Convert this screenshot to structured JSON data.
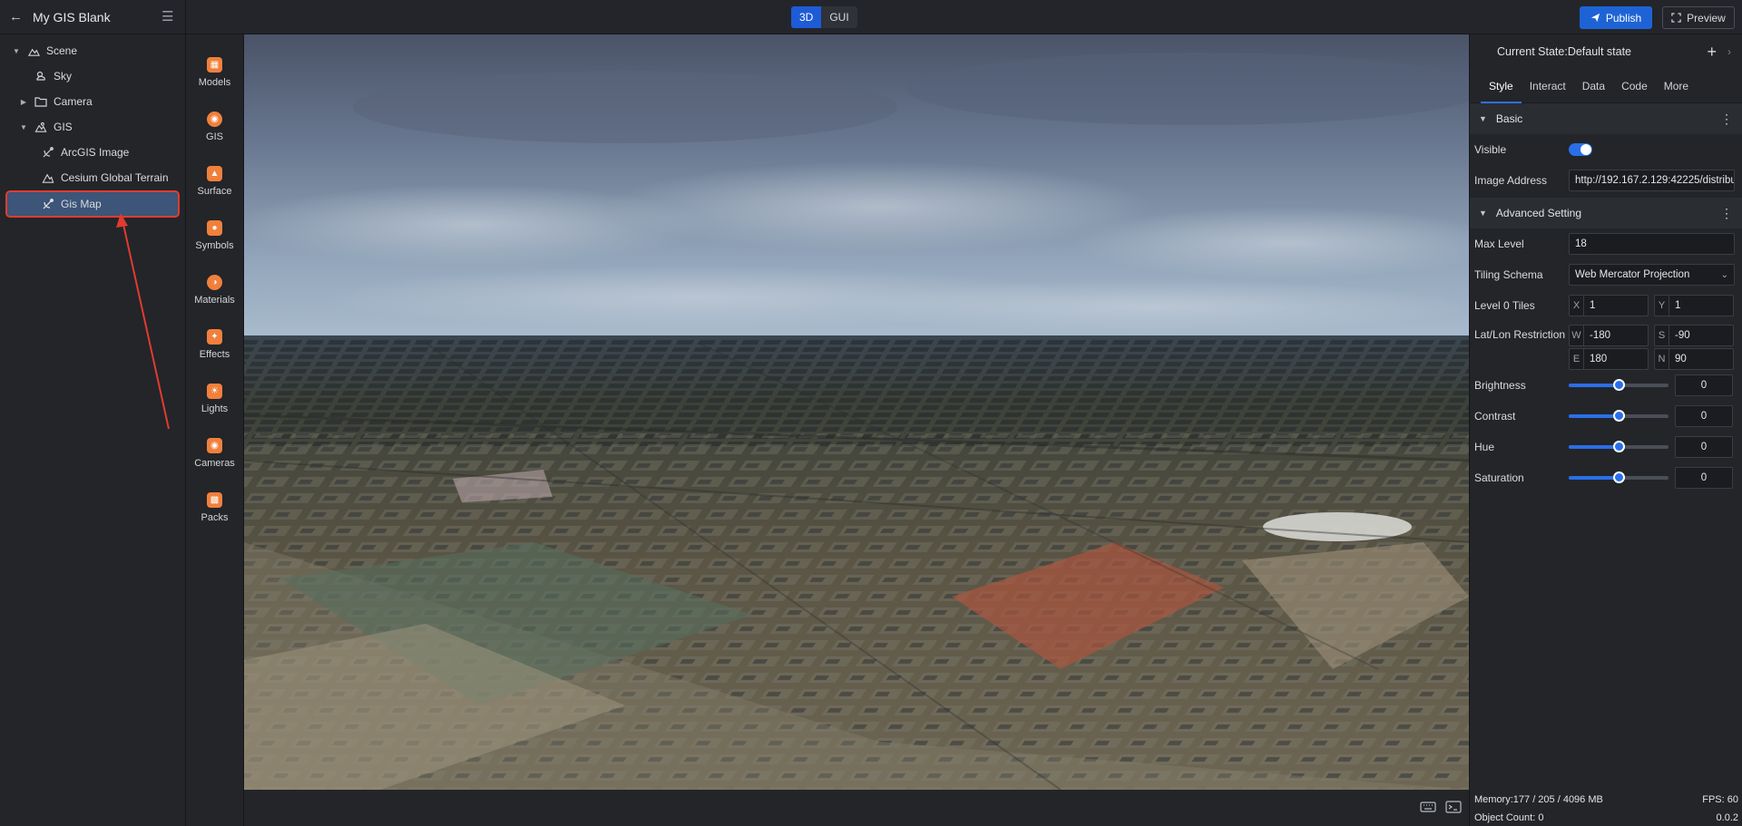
{
  "header": {
    "title": "My GIS Blank",
    "modes": [
      "3D",
      "GUI"
    ],
    "publish_label": "Publish",
    "preview_label": "Preview"
  },
  "tree": [
    {
      "label": "Scene",
      "icon": "scene-icon",
      "expanded": true
    },
    {
      "label": "Sky",
      "icon": "sky-icon"
    },
    {
      "label": "Camera",
      "icon": "folder-icon",
      "expanded": false
    },
    {
      "label": "GIS",
      "icon": "gis-icon",
      "expanded": true
    },
    {
      "label": "ArcGIS Image",
      "icon": "satellite-icon"
    },
    {
      "label": "Cesium Global Terrain",
      "icon": "terrain-icon"
    },
    {
      "label": "Gis Map",
      "icon": "satellite-icon",
      "selected": true
    }
  ],
  "tools": [
    "Models",
    "GIS",
    "Surface",
    "Symbols",
    "Materials",
    "Effects",
    "Lights",
    "Cameras",
    "Packs"
  ],
  "panel": {
    "state_label": "Current State:Default state",
    "tabs": [
      "Style",
      "Interact",
      "Data",
      "Code",
      "More"
    ],
    "basic": {
      "title": "Basic",
      "visible_label": "Visible",
      "visible_on": true,
      "image_address_label": "Image Address",
      "image_address": "http://192.167.2.129:42225/distribut"
    },
    "advanced": {
      "title": "Advanced Setting",
      "max_level_label": "Max Level",
      "max_level": "18",
      "tiling_label": "Tiling Schema",
      "tiling_value": "Web Mercator Projection",
      "level0_label": "Level 0 Tiles",
      "level0_x_key": "X",
      "level0_x": "1",
      "level0_y_key": "Y",
      "level0_y": "1",
      "latlon_label": "Lat/Lon Restriction",
      "w_key": "W",
      "w": "-180",
      "s_key": "S",
      "s": "-90",
      "e_key": "E",
      "e": "180",
      "n_key": "N",
      "n": "90"
    },
    "adjust": [
      {
        "label": "Brightness",
        "value": "0",
        "fraction": 0.5
      },
      {
        "label": "Contrast",
        "value": "0",
        "fraction": 0.5
      },
      {
        "label": "Hue",
        "value": "0",
        "fraction": 0.5
      },
      {
        "label": "Saturation",
        "value": "0",
        "fraction": 0.5
      }
    ]
  },
  "status": {
    "memory": "Memory:177 / 205 / 4096 MB",
    "fps": "FPS: 60",
    "object_count": "Object Count: 0",
    "version": "0.0.2"
  },
  "colors": {
    "accent": "#1e63d6",
    "tool_icon": "#f0803c",
    "selection_outline": "#e03b2f",
    "annotation_arrow": "#e03b2f"
  }
}
